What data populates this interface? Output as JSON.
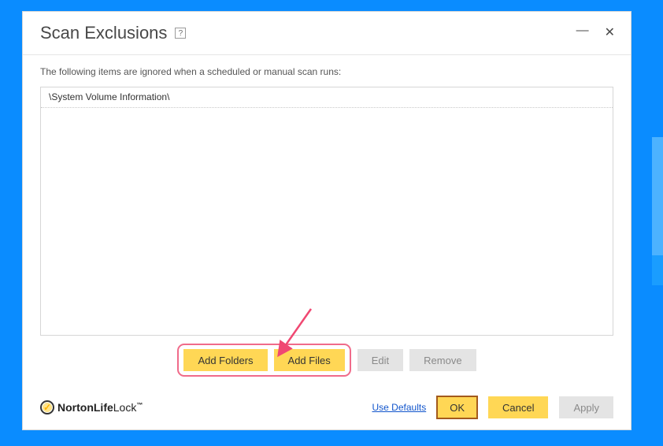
{
  "dialog": {
    "title": "Scan Exclusions",
    "description": "The following items are ignored when a scheduled or manual scan runs:"
  },
  "exclusions": {
    "items": [
      {
        "path": "\\System Volume Information\\"
      }
    ]
  },
  "list_buttons": {
    "add_folders": "Add Folders",
    "add_files": "Add Files",
    "edit": "Edit",
    "remove": "Remove"
  },
  "footer": {
    "brand_strong": "NortonLife",
    "brand_light": "Lock",
    "use_defaults": "Use Defaults",
    "ok": "OK",
    "cancel": "Cancel",
    "apply": "Apply"
  },
  "colors": {
    "accent": "#ffd755",
    "highlight": "#f06b8a"
  }
}
